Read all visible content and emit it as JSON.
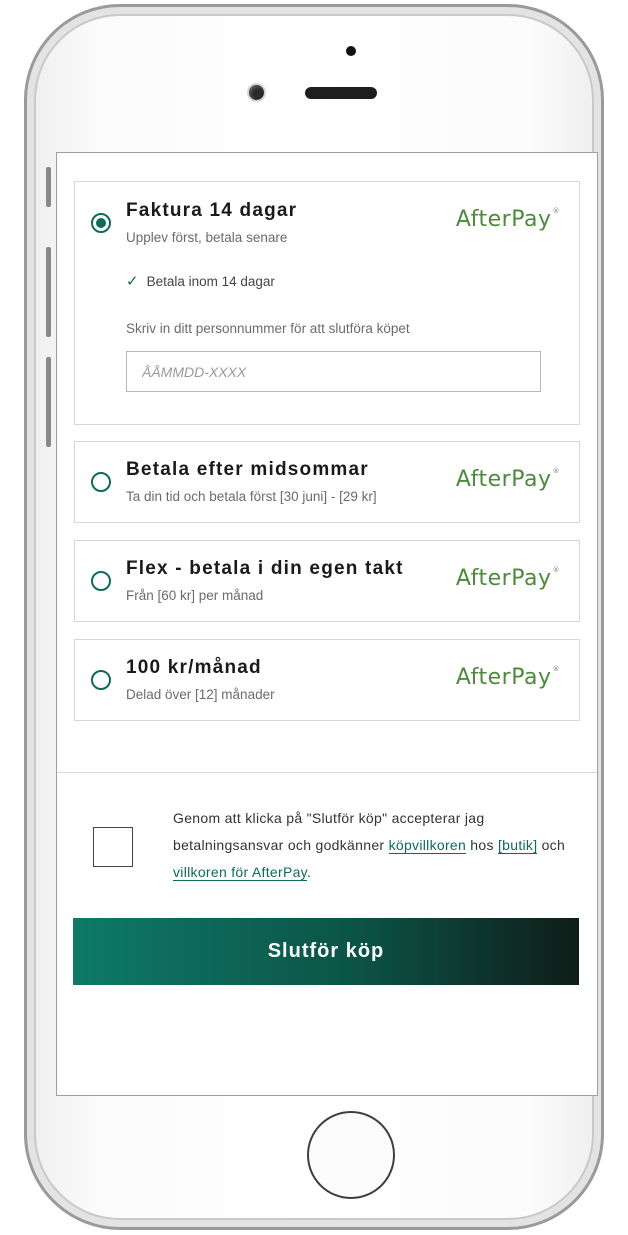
{
  "options": [
    {
      "title": "Faktura 14 dagar",
      "subtitle": "Upplev först, betala senare",
      "logo": "AfterPay",
      "selected": true,
      "check_label": "Betala inom 14 dagar",
      "personal_number_label": "Skriv in ditt personnummer för att slutföra köpet",
      "personal_number_placeholder": "ÅÅMMDD-XXXX",
      "personal_number_value": ""
    },
    {
      "title": "Betala efter midsommar",
      "subtitle": "Ta din tid och betala först [30 juni] - [29 kr]",
      "logo": "AfterPay",
      "selected": false
    },
    {
      "title": "Flex - betala i din egen takt",
      "subtitle": "Från [60 kr] per månad",
      "logo": "AfterPay",
      "selected": false
    },
    {
      "title": "100 kr/månad",
      "subtitle": "Delad över [12] månader",
      "logo": "AfterPay",
      "selected": false
    }
  ],
  "terms": {
    "checked": false,
    "text_before": "Genom att klicka på \"Slutför köp\" accepterar jag betalningsansvar och godkänner ",
    "link1": "köpvillkoren",
    "text_mid1": " hos ",
    "link2": "[butik]",
    "text_mid2": " och ",
    "link3": "villkoren för AfterPay",
    "text_after": "."
  },
  "submit_label": "Slutför köp",
  "colors": {
    "accent": "#0e6b58",
    "logo_green": "#4c8a3c",
    "button_start": "#0e7a67",
    "button_end": "#0e1d18"
  }
}
